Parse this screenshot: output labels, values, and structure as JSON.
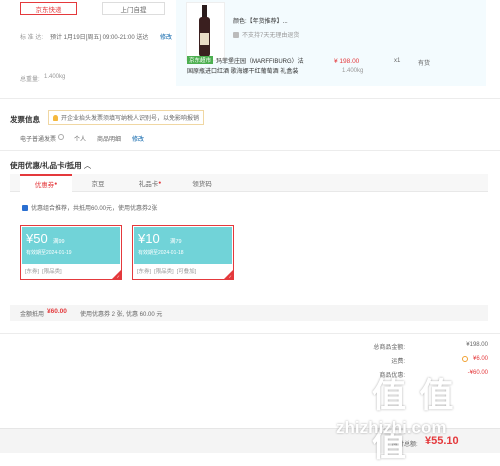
{
  "shipping": {
    "express_label": "京东快递",
    "pickup_label": "上门自提",
    "time_key": "标 准 达:",
    "time_value": "预计 1月19日[周五] 09:00-21:00 送达",
    "modify_label": "修改",
    "weight_label": "总重量:",
    "weight_value": "1.400kg"
  },
  "goods": {
    "color_text": "颜色:【年货推荐】...",
    "return_text": "不支持7天无理由退货",
    "badge": "京东超市",
    "name_line1": "玛菲堡庄园（MARFFIBURG）法",
    "name_line2": "国原瓶进口红酒 歌海娜干红葡萄酒 礼盒装",
    "price": "¥ 198.00",
    "qty": "x1",
    "stock": "有货",
    "weight": "1.400kg"
  },
  "invoice": {
    "title": "发票信息",
    "tip": "开企业抬头发票须填写纳税人识别号，以免影响报销",
    "type": "电子普通发票",
    "holder": "个人",
    "content": "商品明细",
    "modify": "修改"
  },
  "coupon_section": {
    "title": "使用优惠/礼品卡/抵用",
    "tabs": [
      "优惠券",
      "京豆",
      "礼品卡",
      "领货码"
    ],
    "combo_text": "优惠组合推荐，共抵用60.00元，使用优惠券2张",
    "coupons": [
      {
        "amount": "¥50",
        "cond": "满99",
        "date": "有效期至2024-01-19",
        "tags": [
          "[东券]",
          "[限品类]"
        ]
      },
      {
        "amount": "¥10",
        "cond": "满79",
        "date": "有效期至2024-01-18",
        "tags": [
          "[东券]",
          "[限品类]",
          "[可叠加]"
        ]
      }
    ],
    "amount_label": "金额抵用",
    "amount_value": "¥60.00",
    "used_text": "使用优惠券 2 张, 优惠 60.00 元"
  },
  "summary": {
    "total_label": "总商品金额:",
    "total_value": "¥198.00",
    "shipping_label": "运费:",
    "shipping_value": "¥6.00",
    "coupon_label": "商品优惠:",
    "coupon_value": "-¥60.00",
    "pay_label": "应付总额:",
    "pay_value": "¥55.10"
  },
  "watermark": {
    "logo": "值 值 值",
    "url": "zhizhizhi.com"
  }
}
